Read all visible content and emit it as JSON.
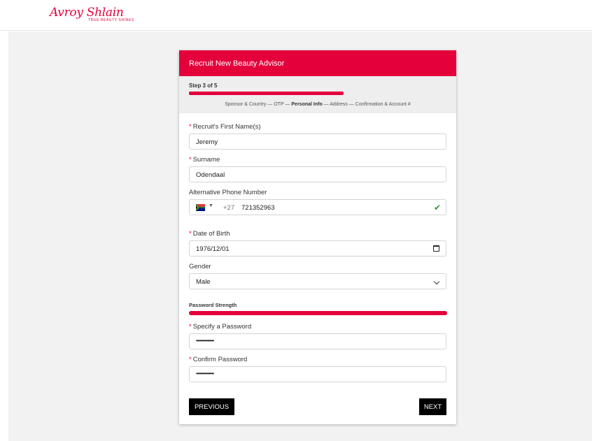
{
  "header": {
    "logo_text": "Avroy Shlain",
    "logo_tagline": "TRUE BEAUTY SHINES"
  },
  "form": {
    "title": "Recruit New Beauty Advisor",
    "step_label": "Step 3 of 5",
    "progress_fraction": 0.6,
    "steps_before": "Sponsor & Country — OTP — ",
    "steps_current": "Personal Info",
    "steps_after": " — Address — Confirmation & Account #",
    "required_marker": "*",
    "first_name": {
      "label": "Recruit's First Name(s)",
      "value": "Jeremy"
    },
    "surname": {
      "label": "Surname",
      "value": "Odendaal"
    },
    "alt_phone": {
      "label": "Alternative Phone Number",
      "dial_code": "+27",
      "value": "721352963",
      "flag_icon": "south-africa-flag-icon",
      "valid_icon": "check-icon"
    },
    "dob": {
      "label": "Date of Birth",
      "value": "1976/12/01",
      "icon": "calendar-icon"
    },
    "gender": {
      "label": "Gender",
      "value": "Male",
      "icon": "chevron-down-icon"
    },
    "password_strength": {
      "label": "Password Strength",
      "fraction": 1.0
    },
    "password": {
      "label": "Specify a Password",
      "value": "••••••••••••••"
    },
    "confirm_password": {
      "label": "Confirm Password",
      "value": "••••••••••••••"
    },
    "previous_label": "PREVIOUS",
    "next_label": "NEXT"
  },
  "colors": {
    "brand": "#e4003b",
    "valid": "#2e9b2e",
    "button": "#000000"
  }
}
